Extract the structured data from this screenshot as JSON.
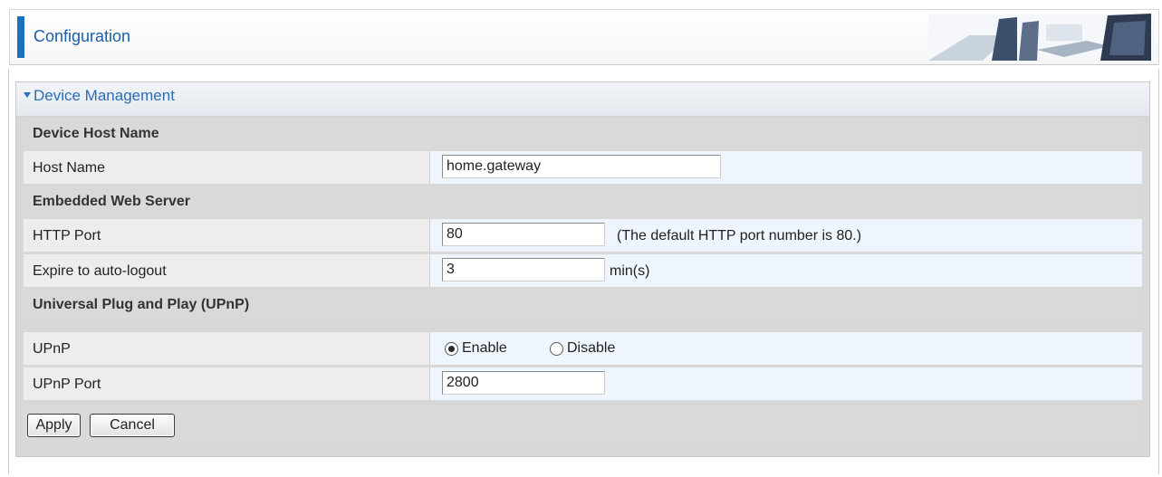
{
  "header": {
    "title": "Configuration"
  },
  "section": {
    "title": "Device Management"
  },
  "groups": {
    "host": "Device Host Name",
    "web": "Embedded Web Server",
    "upnp": "Universal Plug and Play (UPnP)"
  },
  "fields": {
    "host_name": {
      "label": "Host Name",
      "value": "home.gateway"
    },
    "http_port": {
      "label": "HTTP Port",
      "value": "80",
      "hint": "(The default HTTP port number is 80.)"
    },
    "expire": {
      "label": "Expire to auto-logout",
      "value": "3",
      "unit": "min(s)"
    },
    "upnp": {
      "label": "UPnP",
      "enable_label": "Enable",
      "disable_label": "Disable",
      "selected": "Enable"
    },
    "upnp_port": {
      "label": "UPnP Port",
      "value": "2800"
    }
  },
  "buttons": {
    "apply": "Apply",
    "cancel": "Cancel"
  },
  "colors": {
    "accent": "#1f6fc0",
    "section_title": "#2a6cb5",
    "value_bg": "#eef5fc",
    "label_bg": "#ededed",
    "group_bg": "#d9d9d9"
  }
}
